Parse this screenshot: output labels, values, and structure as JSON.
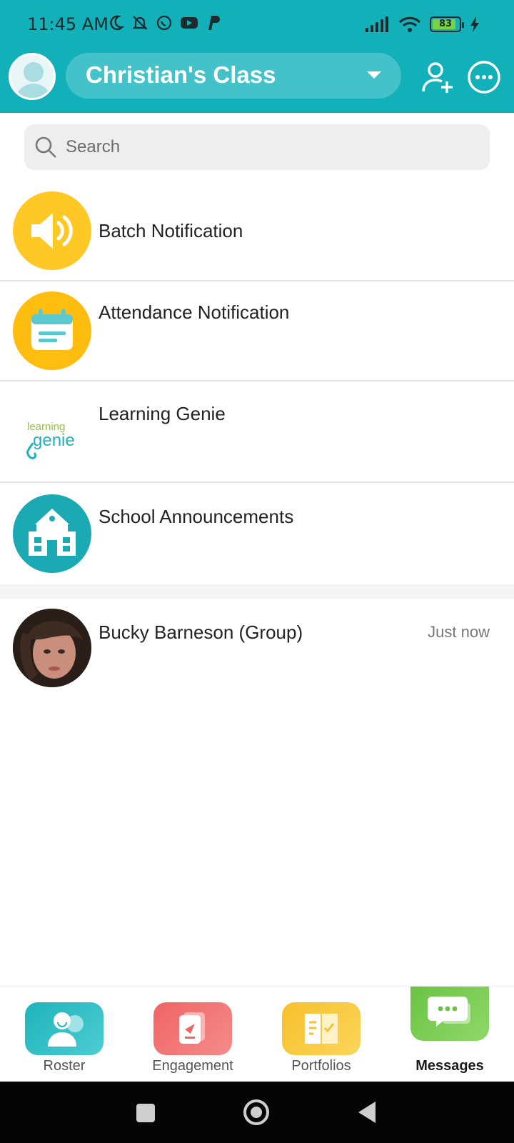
{
  "status_bar": {
    "time": "11:45 AM",
    "battery_level": "83",
    "icons_left": [
      "moon-icon",
      "bell-off-icon",
      "whatsapp-icon",
      "youtube-icon",
      "paypal-icon"
    ],
    "icons_right": [
      "signal-icon",
      "wifi-icon",
      "battery-icon",
      "charging-icon"
    ]
  },
  "header": {
    "class_name": "Christian's Class",
    "avatar": "avatar-placeholder",
    "actions": [
      "add-user-icon",
      "more-icon"
    ]
  },
  "search": {
    "placeholder": "Search"
  },
  "notifications": [
    {
      "label": "Batch Notification",
      "icon": "speaker-icon",
      "color": "#FFC824"
    },
    {
      "label": "Attendance Notification",
      "icon": "calendar-icon",
      "color": "#FFBE0F"
    },
    {
      "label": "Learning Genie",
      "icon": "learning-genie-logo",
      "color": "#ffffff"
    },
    {
      "label": "School Announcements",
      "icon": "school-icon",
      "color": "#1BA9B3"
    }
  ],
  "conversations": [
    {
      "label": "Bucky Barneson (Group)",
      "time": "Just now",
      "icon": "child-photo-avatar"
    }
  ],
  "bottom_nav": [
    {
      "label": "Roster",
      "icon": "roster-icon",
      "color": "#20B7BD",
      "active": false
    },
    {
      "label": "Engagement",
      "icon": "engagement-icon",
      "color": "#F16C6C",
      "active": false
    },
    {
      "label": "Portfolios",
      "icon": "portfolio-icon",
      "color": "#F9C531",
      "active": false
    },
    {
      "label": "Messages",
      "icon": "messages-icon",
      "color": "#72C54A",
      "active": true
    }
  ],
  "colors": {
    "brand_teal": "#12B0B8",
    "select_teal": "#44C2C9"
  }
}
